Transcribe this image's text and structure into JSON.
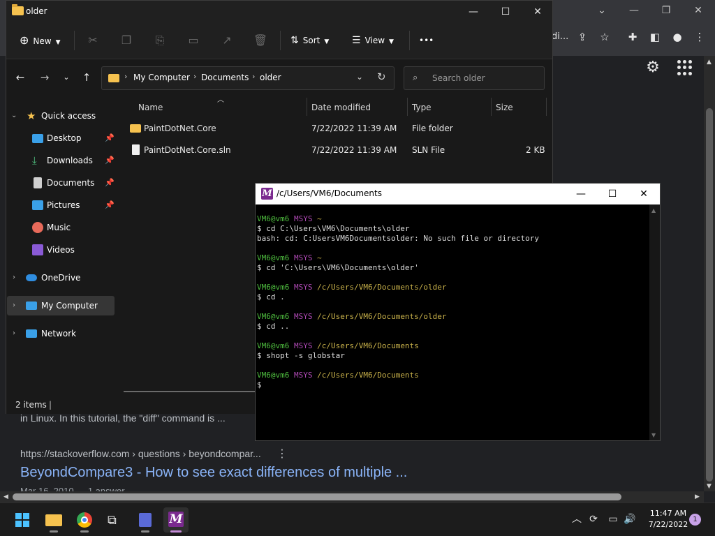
{
  "chrome": {
    "omnibox_text": "di...",
    "window_buttons": {
      "minimize": "—",
      "restore": "❐",
      "close": "✕",
      "tab_search": "⌄"
    }
  },
  "search_results": {
    "snippet": "in Linux. In this tutorial, the \"diff\" command is ...",
    "url": "https://stackoverflow.com › questions › beyondcompar...",
    "title": "BeyondCompare3 - How to see exact differences of multiple ...",
    "date": "Mar 16, 2010 — 1 answer"
  },
  "explorer": {
    "title": "older",
    "toolbar": {
      "new": "New",
      "sort": "Sort",
      "view": "View",
      "more": "•••"
    },
    "breadcrumb": [
      "My Computer",
      "Documents",
      "older"
    ],
    "search_placeholder": "Search older",
    "nav": {
      "quick_access": "Quick access",
      "desktop": "Desktop",
      "downloads": "Downloads",
      "documents": "Documents",
      "pictures": "Pictures",
      "music": "Music",
      "videos": "Videos",
      "onedrive": "OneDrive",
      "my_computer": "My Computer",
      "network": "Network"
    },
    "columns": {
      "name": "Name",
      "date": "Date modified",
      "type": "Type",
      "size": "Size"
    },
    "files": [
      {
        "name": "PaintDotNet.Core",
        "date": "7/22/2022 11:39 AM",
        "type": "File folder",
        "size": ""
      },
      {
        "name": "PaintDotNet.Core.sln",
        "date": "7/22/2022 11:39 AM",
        "type": "SLN File",
        "size": "2 KB"
      }
    ],
    "status": "2 items"
  },
  "terminal": {
    "title": "/c/Users/VM6/Documents",
    "logo": "M",
    "lines": [
      {
        "user": "VM6@vm6",
        "sys": "MSYS",
        "path": "~"
      },
      {
        "text": "$ cd C:\\Users\\VM6\\Documents\\older"
      },
      {
        "text": "bash: cd: C:UsersVM6Documentsolder: No such file or directory"
      },
      {
        "text": ""
      },
      {
        "user": "VM6@vm6",
        "sys": "MSYS",
        "path": "~"
      },
      {
        "text": "$ cd 'C:\\Users\\VM6\\Documents\\older'"
      },
      {
        "text": ""
      },
      {
        "user": "VM6@vm6",
        "sys": "MSYS",
        "path": "/c/Users/VM6/Documents/older"
      },
      {
        "text": "$ cd ."
      },
      {
        "text": ""
      },
      {
        "user": "VM6@vm6",
        "sys": "MSYS",
        "path": "/c/Users/VM6/Documents/older"
      },
      {
        "text": "$ cd .."
      },
      {
        "text": ""
      },
      {
        "user": "VM6@vm6",
        "sys": "MSYS",
        "path": "/c/Users/VM6/Documents"
      },
      {
        "text": "$ shopt -s globstar"
      },
      {
        "text": ""
      },
      {
        "user": "VM6@vm6",
        "sys": "MSYS",
        "path": "/c/Users/VM6/Documents"
      },
      {
        "text": "$"
      }
    ]
  },
  "taskbar": {
    "time": "11:47 AM",
    "date": "7/22/2022",
    "notifications": "1"
  },
  "colors": {
    "terminal_user": "#4fbf3f",
    "terminal_sys": "#b04ab6",
    "terminal_path": "#c8b14a",
    "link": "#8ab4f8",
    "folder": "#f6c24f",
    "msys": "#7b2a8f"
  }
}
